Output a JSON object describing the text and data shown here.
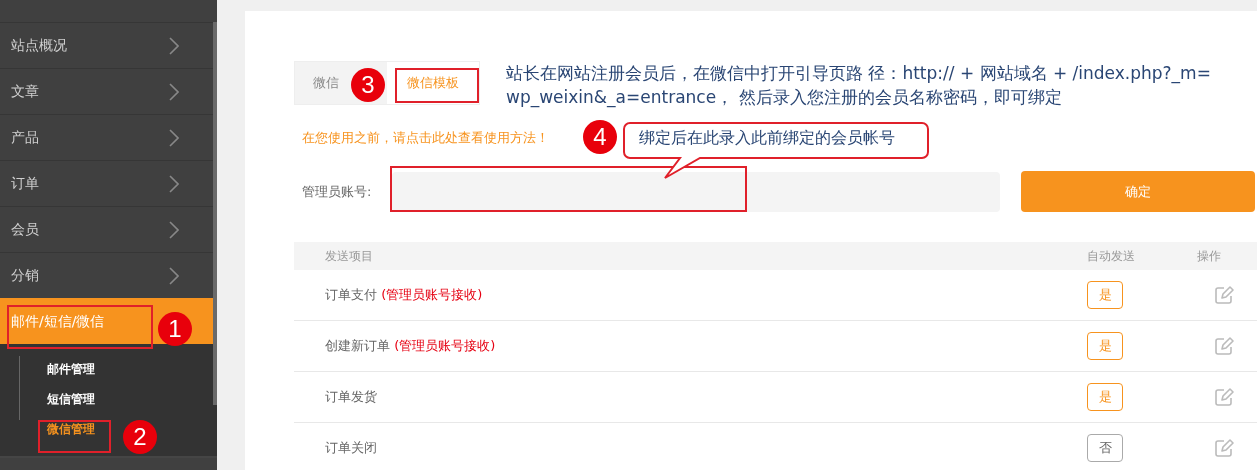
{
  "sidebar": {
    "items": [
      {
        "label": "站点概况",
        "selected": false
      },
      {
        "label": "文章",
        "selected": false
      },
      {
        "label": "产品",
        "selected": false
      },
      {
        "label": "订单",
        "selected": false
      },
      {
        "label": "会员",
        "selected": false
      },
      {
        "label": "分销",
        "selected": false
      },
      {
        "label": "邮件/短信/微信",
        "selected": true,
        "children": [
          {
            "label": "邮件管理",
            "selected": false
          },
          {
            "label": "短信管理",
            "selected": false
          },
          {
            "label": "微信管理",
            "selected": true
          }
        ]
      }
    ]
  },
  "tabs": [
    {
      "label": "微信",
      "selected": false
    },
    {
      "label": "微信模板",
      "selected": true
    }
  ],
  "description_lines": [
    "站长在网站注册会员后，在微信中打开引导页路 径：http:// + 网站域名 + /index.php?_m=",
    "wp_weixin&_a=entrance， 然后录入您注册的会员名称密码，即可绑定"
  ],
  "help_link": "在您使用之前，请点击此处查看使用方法！",
  "account": {
    "label": "管理员账号:",
    "submit": "确定"
  },
  "table": {
    "columns": [
      "发送项目",
      "自动发送",
      "操作"
    ],
    "rows": [
      {
        "label": "订单支付",
        "note": "(管理员账号接收)",
        "auto_send": {
          "text": "是",
          "on": true
        }
      },
      {
        "label": "创建新订单",
        "note": "(管理员账号接收)",
        "auto_send": {
          "text": "是",
          "on": true
        }
      },
      {
        "label": "订单发货",
        "auto_send": {
          "text": "是",
          "on": true
        }
      },
      {
        "label": "订单关闭",
        "auto_send": {
          "text": "否",
          "on": false
        }
      }
    ]
  },
  "annotations": {
    "markers": [
      "1",
      "2",
      "3",
      "4"
    ],
    "callout": "绑定后在此录入此前绑定的会员帐号"
  }
}
